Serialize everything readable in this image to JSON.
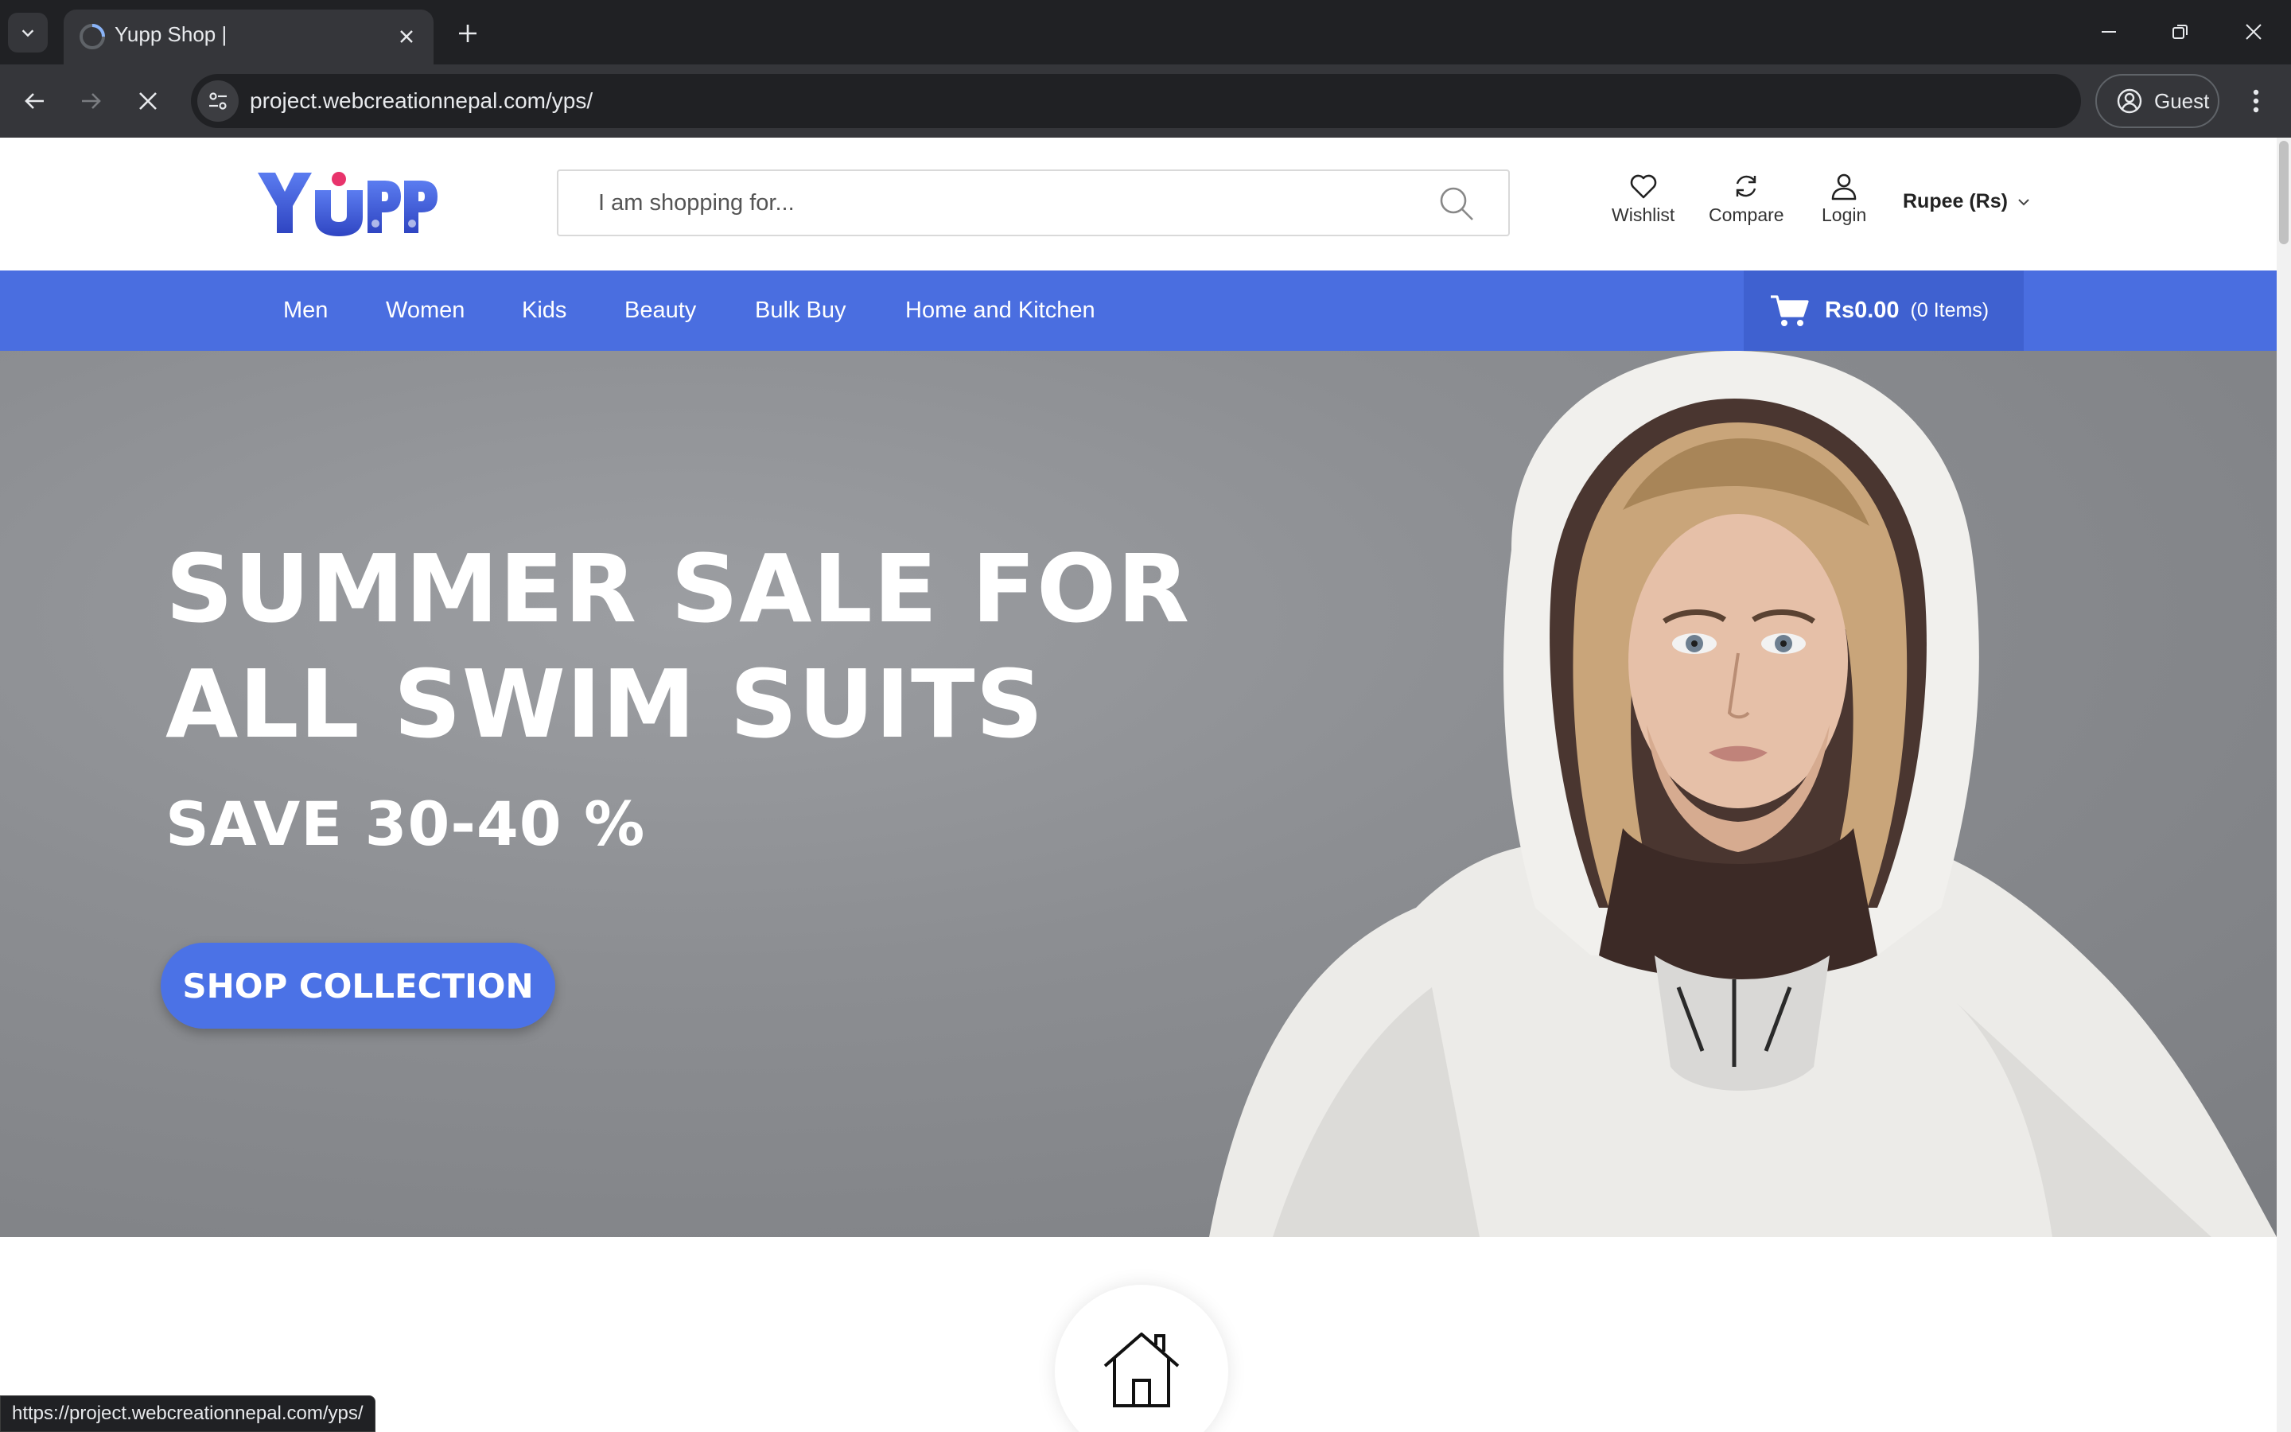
{
  "browser": {
    "tab_title": "Yupp Shop |",
    "url": "project.webcreationnepal.com/yps/",
    "profile_label": "Guest",
    "status_url": "https://project.webcreationnepal.com/yps/"
  },
  "header": {
    "brand": "Yupp",
    "search_placeholder": "I am shopping for...",
    "actions": {
      "wishlist": "Wishlist",
      "compare": "Compare",
      "login": "Login"
    },
    "currency": "Rupee (Rs)"
  },
  "nav": {
    "items": [
      "Men",
      "Women",
      "Kids",
      "Beauty",
      "Bulk Buy",
      "Home and Kitchen"
    ],
    "cart_total": "Rs0.00",
    "cart_count": "(0 Items)"
  },
  "hero": {
    "line1": "SUMMER SALE FOR",
    "line2": "ALL SWIM SUITS",
    "line3": "SAVE 30-40 %",
    "cta": "SHOP COLLECTION"
  },
  "colors": {
    "brand_blue": "#4a6ee0",
    "cart_blue": "#3f61d0",
    "cta_blue": "#4b72e6",
    "logo_blue": "#3d5bd6"
  },
  "icons": {
    "category": "home-icon"
  }
}
